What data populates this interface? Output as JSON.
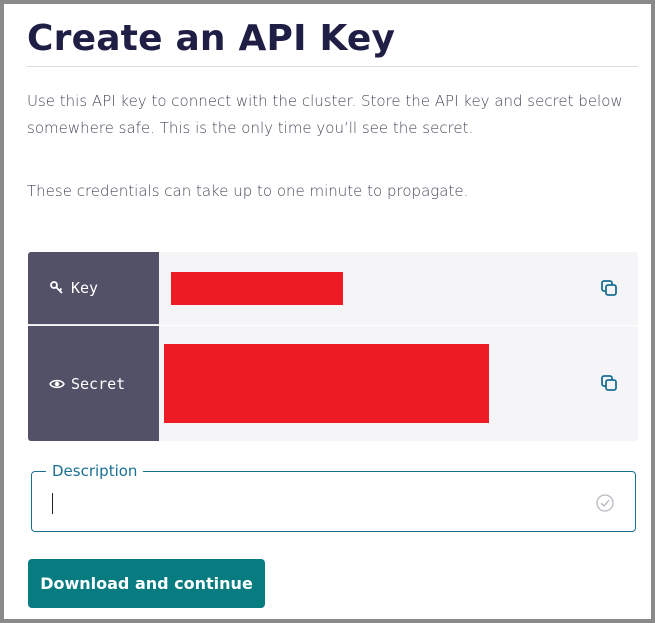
{
  "dialog": {
    "title": "Create an API Key",
    "intro_text": "Use this API key to connect with the cluster. Store the API key and secret below somewhere safe. This is the only time you’ll see the secret.",
    "propagation_text": "These credentials can take up to one minute to propagate."
  },
  "credentials": {
    "key": {
      "label": "Key",
      "icon": "key-icon",
      "value_state": "redacted",
      "copy_icon": "copy-icon"
    },
    "secret": {
      "label": "Secret",
      "icon": "eye-icon",
      "value_state": "redacted",
      "copy_icon": "copy-icon"
    },
    "redaction_color": "#ed1c24"
  },
  "description_field": {
    "legend": "Description",
    "value": "",
    "placeholder": "",
    "status_icon": "check-circle-icon"
  },
  "actions": {
    "primary_label": "Download and continue"
  },
  "colors": {
    "title": "#1f1f46",
    "label_cell": "#535168",
    "accent": "#1b6f92",
    "primary_button": "#077c80"
  }
}
